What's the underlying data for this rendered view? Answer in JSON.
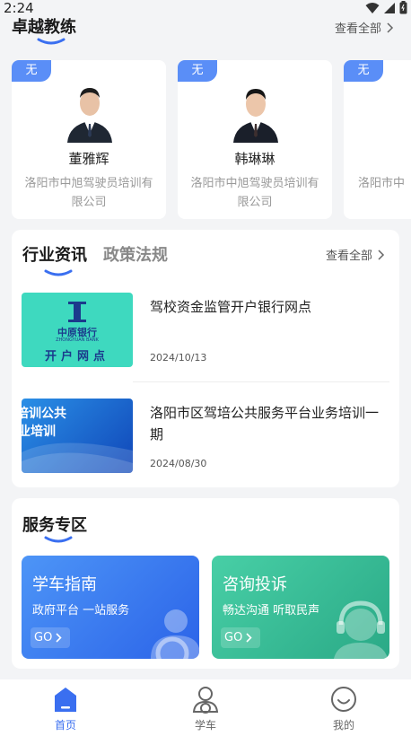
{
  "status_bar": {
    "time": "2:24"
  },
  "coaches_section": {
    "title": "卓越教练",
    "more_label": "查看全部",
    "coaches": [
      {
        "badge": "无",
        "name": "董雅辉",
        "org": "洛阳市中旭驾驶员培训有限公司"
      },
      {
        "badge": "无",
        "name": "韩琳琳",
        "org": "洛阳市中旭驾驶员培训有限公司"
      },
      {
        "badge": "无",
        "name": "",
        "org": "洛阳市中"
      }
    ]
  },
  "news_section": {
    "tabs": [
      {
        "label": "行业资讯",
        "active": true
      },
      {
        "label": "政策法规",
        "active": false
      }
    ],
    "more_label": "查看全部",
    "items": [
      {
        "title": "驾校资金监管开户银行网点",
        "date": "2024/10/13",
        "thumb_lines": [
          "中原银行",
          "ZHONGYUAN BANK",
          "开户网点"
        ]
      },
      {
        "title": "洛阳市区驾培公共服务平台业务培训一期",
        "date": "2024/08/30",
        "thumb_lines": [
          "培训公共",
          "业培训"
        ]
      }
    ]
  },
  "services_section": {
    "title": "服务专区",
    "cards": [
      {
        "title": "学车指南",
        "subtitle": "政府平台 一站服务",
        "button": "GO",
        "color_from": "#3f8af5",
        "color_to": "#2a62e6"
      },
      {
        "title": "咨询投诉",
        "subtitle": "畅达沟通 听取民声",
        "button": "GO",
        "color_from": "#3dc6a0",
        "color_to": "#2dae8c"
      }
    ]
  },
  "tabbar": {
    "items": [
      {
        "label": "首页",
        "icon": "home-icon",
        "active": true
      },
      {
        "label": "学车",
        "icon": "learner-icon",
        "active": false
      },
      {
        "label": "我的",
        "icon": "smile-face-icon",
        "active": false
      }
    ]
  }
}
